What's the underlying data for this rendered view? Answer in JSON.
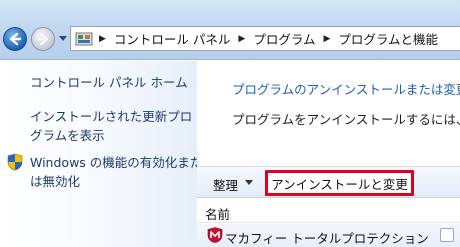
{
  "address_bar": {
    "breadcrumbs": [
      "コントロール パネル",
      "プログラム",
      "プログラムと機能"
    ]
  },
  "left_pane": {
    "links": [
      {
        "label": "コントロール パネル ホーム"
      },
      {
        "label_line1": "インストールされた更新プロ",
        "label_line2": "グラムを表示"
      },
      {
        "label_line1": "Windows の機能の有効化また",
        "label_line2": "は無効化"
      }
    ]
  },
  "main": {
    "heading_link": "プログラムのアンインストールまたは変更",
    "description": "プログラムをアンインストールするには、"
  },
  "toolbar": {
    "organize_label": "整理",
    "uninstall_change_label": "アンインストールと変更"
  },
  "list": {
    "column_name": "名前",
    "rows": [
      {
        "name": "マカフィー トータルプロテクション"
      }
    ]
  },
  "colors": {
    "highlight_border": "#e3001b",
    "link_blue": "#1a5fb4"
  }
}
